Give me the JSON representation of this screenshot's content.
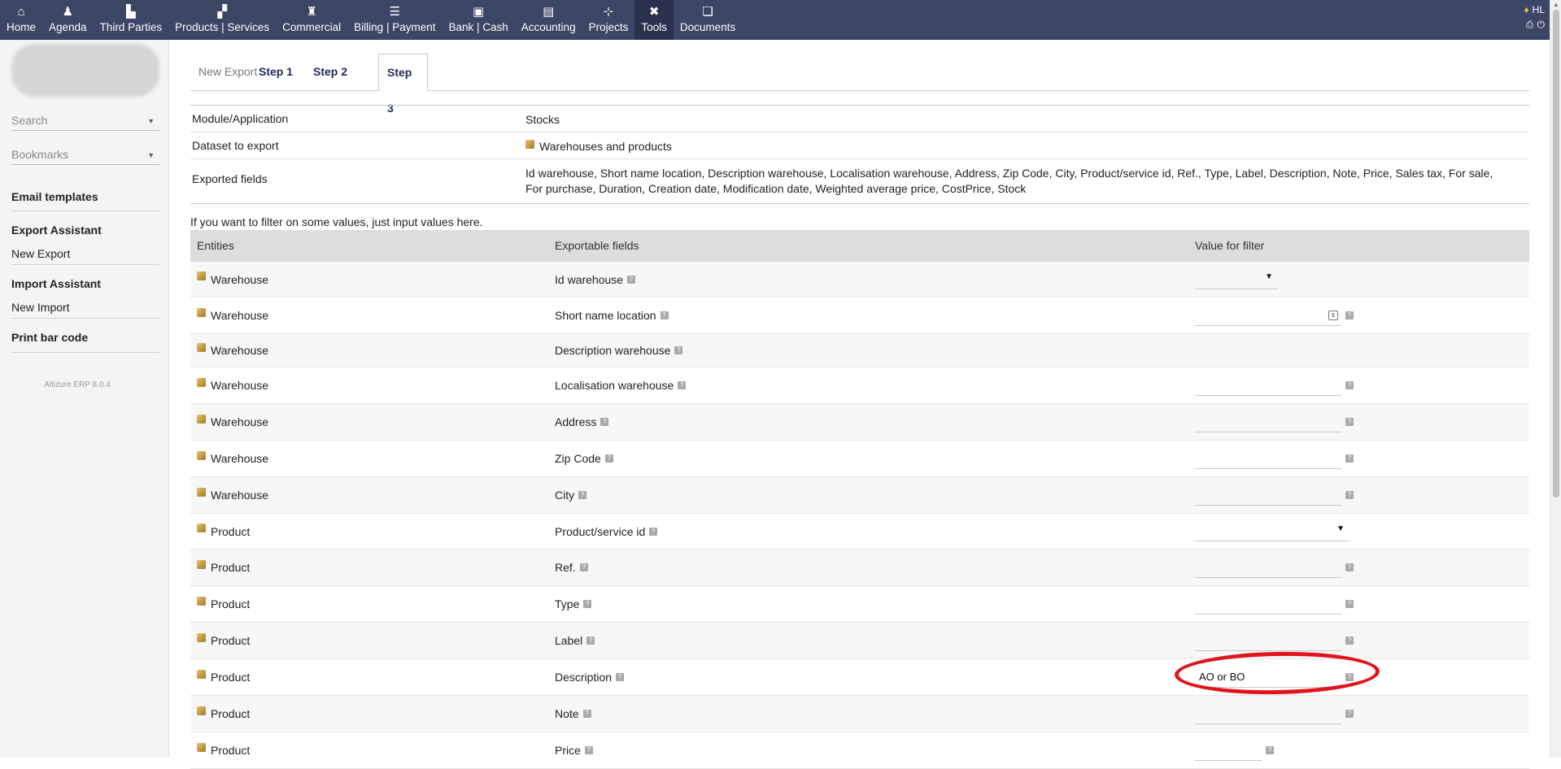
{
  "topbar": {
    "nav": [
      {
        "label": "Home",
        "icon": "home-icon"
      },
      {
        "label": "Agenda",
        "icon": "agenda-icon"
      },
      {
        "label": "Third Parties",
        "icon": "buildings-icon"
      },
      {
        "label": "Products | Services",
        "icon": "cubes-icon"
      },
      {
        "label": "Commercial",
        "icon": "suitcase-icon"
      },
      {
        "label": "Billing | Payment",
        "icon": "coins-icon"
      },
      {
        "label": "Bank | Cash",
        "icon": "safe-icon"
      },
      {
        "label": "Accounting",
        "icon": "money-icon"
      },
      {
        "label": "Projects",
        "icon": "sitemap-icon"
      },
      {
        "label": "Tools",
        "icon": "tools-icon"
      },
      {
        "label": "Documents",
        "icon": "folders-icon"
      }
    ],
    "active_index": 9,
    "user_initials": "HL"
  },
  "sidebar": {
    "search_placeholder": "Search",
    "bookmarks_label": "Bookmarks",
    "email_templates": "Email templates",
    "export_assistant": "Export Assistant",
    "new_export": "New Export",
    "import_assistant": "Import Assistant",
    "new_import": "New Import",
    "print_bar_code": "Print bar code",
    "version": "Altizure ERP 8.0.4"
  },
  "tabs": [
    {
      "label": "New Export"
    },
    {
      "label": "Step 1"
    },
    {
      "label": "Step 2"
    },
    {
      "label": "Step 3"
    }
  ],
  "summary": {
    "module_label": "Module/Application",
    "module_value": "Stocks",
    "dataset_label": "Dataset to export",
    "dataset_value": "Warehouses and products",
    "fields_label": "Exported fields",
    "fields_value": "Id warehouse, Short name location, Description warehouse, Localisation warehouse, Address, Zip Code, City, Product/service id, Ref., Type, Label, Description, Note, Price, Sales tax, For sale, For purchase, Duration, Creation date, Modification date, Weighted average price, CostPrice, Stock"
  },
  "hint": "If you want to filter on some values, just input values here.",
  "grid": {
    "headers": {
      "entities": "Entities",
      "fields": "Exportable fields",
      "filter": "Value for filter"
    },
    "rows": [
      {
        "entity": "Warehouse",
        "field": "Id warehouse",
        "filter_value": ""
      },
      {
        "entity": "Warehouse",
        "field": "Short name location",
        "filter_value": ""
      },
      {
        "entity": "Warehouse",
        "field": "Description warehouse",
        "filter_value": ""
      },
      {
        "entity": "Warehouse",
        "field": "Localisation warehouse",
        "filter_value": ""
      },
      {
        "entity": "Warehouse",
        "field": "Address",
        "filter_value": ""
      },
      {
        "entity": "Warehouse",
        "field": "Zip Code",
        "filter_value": ""
      },
      {
        "entity": "Warehouse",
        "field": "City",
        "filter_value": ""
      },
      {
        "entity": "Product",
        "field": "Product/service id",
        "filter_value": ""
      },
      {
        "entity": "Product",
        "field": "Ref.",
        "filter_value": ""
      },
      {
        "entity": "Product",
        "field": "Type",
        "filter_value": ""
      },
      {
        "entity": "Product",
        "field": "Label",
        "filter_value": ""
      },
      {
        "entity": "Product",
        "field": "Description",
        "filter_value": "AO or BO"
      },
      {
        "entity": "Product",
        "field": "Note",
        "filter_value": ""
      },
      {
        "entity": "Product",
        "field": "Price",
        "filter_value": ""
      }
    ]
  },
  "colors": {
    "topbar": "#3b4565",
    "active_nav": "#29314c",
    "annotation": "#e0141d"
  }
}
